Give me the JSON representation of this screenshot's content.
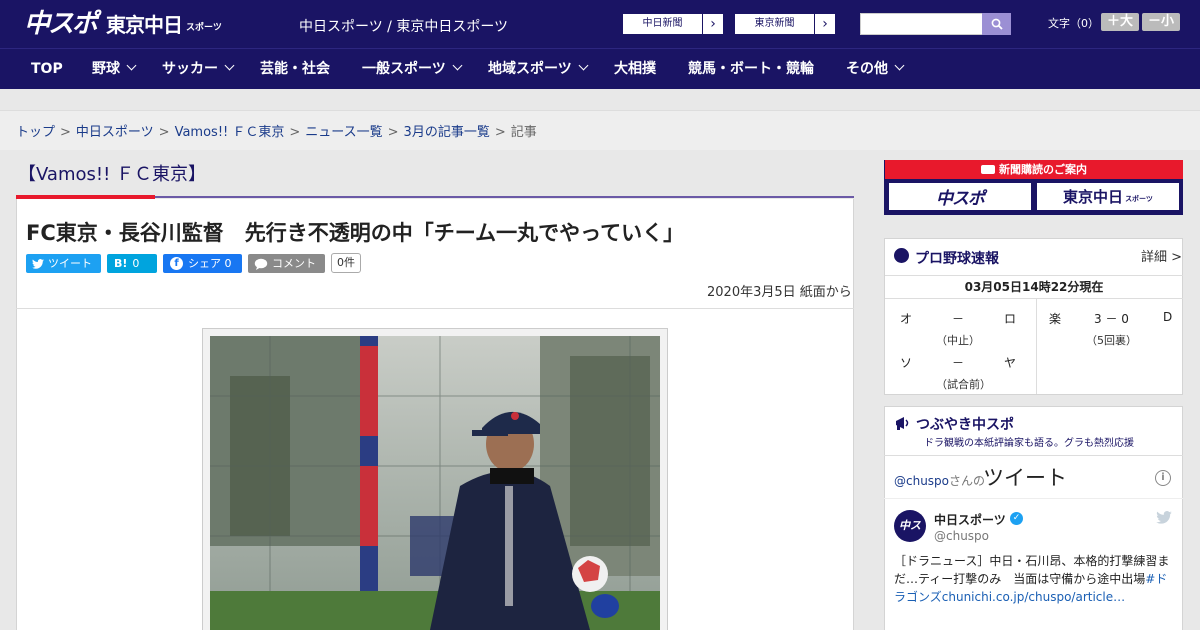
{
  "header": {
    "logo_main": "中スポ",
    "logo_tokyo": "東京中日",
    "logo_sports": "スポーツ",
    "site_title": "中日スポーツ / 東京中日スポーツ",
    "ext_links": [
      {
        "label": "中日新聞",
        "arrow": "›"
      },
      {
        "label": "東京新聞",
        "arrow": "›"
      }
    ],
    "search": {
      "placeholder": ""
    },
    "font_size": {
      "label": "文字（0）",
      "increase": "＋大",
      "decrease": "－小"
    }
  },
  "nav": {
    "items": [
      {
        "label": "TOP"
      },
      {
        "label": "野球"
      },
      {
        "label": "サッカー"
      },
      {
        "label": "芸能・社会"
      },
      {
        "label": "一般スポーツ"
      },
      {
        "label": "地域スポーツ"
      },
      {
        "label": "大相撲"
      },
      {
        "label": "競馬・ボート・競輪"
      },
      {
        "label": "その他"
      }
    ]
  },
  "breadcrumb": {
    "items": [
      "トップ",
      "中日スポーツ",
      "Vamos!! ＦＣ東京",
      "ニュース一覧",
      "3月の記事一覧"
    ],
    "current": "記事",
    "separator": ">"
  },
  "article": {
    "section": "【Vamos!! ＦＣ東京】",
    "headline": "FC東京・長谷川監督　先行き不透明の中「チーム一丸でやっていく」",
    "share": {
      "tweet": "ツイート",
      "hatena_icon": "B!",
      "hatena_count": "0",
      "facebook": "シェア 0",
      "comment": "コメント",
      "comment_count": "0件"
    },
    "date": "2020年3月5日 紙面から",
    "colors": {
      "accent_red": "#e8192c",
      "navy": "#1a1464",
      "purple": "#6b5aa6"
    }
  },
  "sidebar": {
    "subscribe": {
      "title": "新聞購読のご案内",
      "logo1": "中スポ",
      "logo2": "東京中日",
      "logo2_suffix": "スポーツ"
    },
    "pro_baseball": {
      "title": "プロ野球速報",
      "detail": "詳細 >",
      "time": "03月05日14時22分現在",
      "games": [
        {
          "home": "オ",
          "score": "－",
          "away": "ロ",
          "status": "（中止）"
        },
        {
          "home": "楽",
          "score": "3 － 0",
          "away": "D",
          "status": "（5回裏）"
        },
        {
          "home": "ソ",
          "score": "－",
          "away": "ヤ",
          "status": "（試合前）"
        }
      ]
    },
    "twitter": {
      "title": "つぶやき中スポ",
      "subtitle": "ドラ観戦の本紙評論家も語る。グラも熱烈応援",
      "header_handle": "@chuspo",
      "header_suffix": "さんの",
      "header_tweet": "ツイート",
      "info": "i",
      "tweet": {
        "avatar": "中スポ",
        "name": "中日スポーツ",
        "handle": "@chuspo",
        "text": "［ドラニュース］中日・石川昂、本格的打撃練習まだ…ティー打撃のみ　当面は守備から途中出場",
        "hashtag": "#ドラゴンズ",
        "link": "chunichi.co.jp/chuspo/article…"
      }
    }
  }
}
